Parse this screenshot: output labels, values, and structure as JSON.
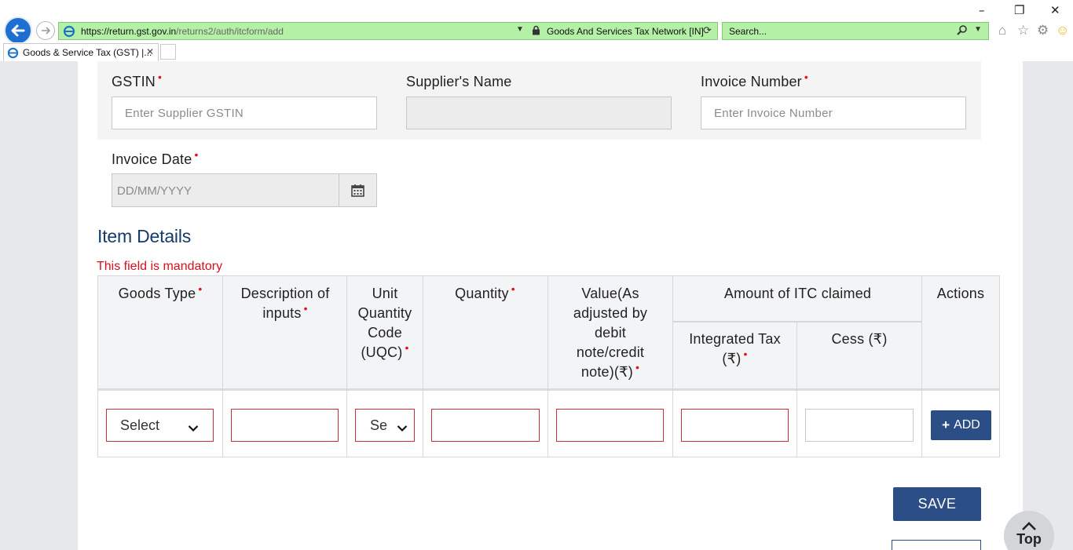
{
  "browser": {
    "url_host": "https://return.gst.gov.in",
    "url_path": "/returns2/auth/itcform/add",
    "cert_label": "Goods And Services Tax Network [IN]",
    "search_placeholder": "Search...",
    "tab_title": "Goods & Service Tax (GST) |...",
    "icons": [
      "back-arrow-icon",
      "forward-arrow-icon",
      "lock-icon",
      "refresh-icon",
      "search-icon",
      "home-icon",
      "star-icon",
      "gear-icon",
      "smiley-icon"
    ]
  },
  "form": {
    "gstin_label": "GSTIN",
    "gstin_placeholder": "Enter Supplier GSTIN",
    "supplier_name_label": "Supplier's Name",
    "invoice_number_label": "Invoice Number",
    "invoice_number_placeholder": "Enter Invoice Number",
    "invoice_date_label": "Invoice Date",
    "invoice_date_placeholder": "DD/MM/YYYY",
    "required_marker": "•"
  },
  "items": {
    "title": "Item Details",
    "mandatory_message": "This field is mandatory",
    "headers": {
      "goods_type": "Goods Type",
      "description": "Description of inputs",
      "uqc": "Unit Quantity Code (UQC)",
      "quantity": "Quantity",
      "value": "Value(As adjusted by debit note/credit note)(₹)",
      "itc_group": "Amount of ITC claimed",
      "integrated_tax": "Integrated Tax (₹)",
      "cess": "Cess (₹)",
      "actions": "Actions"
    },
    "row": {
      "goods_type_select": "Select",
      "uqc_select": "Se"
    },
    "add_label": "ADD",
    "add_plus": "+"
  },
  "actions": {
    "save_label": "SAVE",
    "top_label": "Top"
  },
  "colors": {
    "primary": "#2c4e86",
    "required": "#e8101a",
    "error_border": "#c9303c",
    "title": "#163a6a",
    "address_bar": "#b4f0a6"
  }
}
